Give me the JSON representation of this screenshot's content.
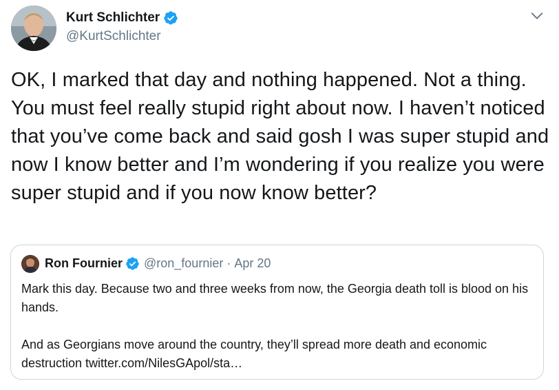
{
  "tweet": {
    "author": {
      "display_name": "Kurt Schlichter",
      "handle": "@KurtSchlichter",
      "verified": true,
      "avatar_icon": "profile-photo"
    },
    "menu_icon": "chevron-down-icon",
    "text": "OK, I marked that day and nothing happened. Not a thing. You must feel really stupid right about now. I haven’t noticed that you’ve come back and said gosh I was super stupid and now I know better and I’m wondering if you realize you were super stupid and if you now know better?"
  },
  "quoted_tweet": {
    "author": {
      "display_name": "Ron Fournier",
      "handle": "@ron_fournier",
      "verified": true,
      "avatar_icon": "profile-photo"
    },
    "separator": "·",
    "date": "Apr 20",
    "paragraph_1": "Mark this day. Because two and three weeks from now, the Georgia death toll is blood on his hands.",
    "paragraph_2": "And as Georgians move around the country, they’ll spread more death and economic destruction twitter.com/NilesGApol/sta…"
  },
  "colors": {
    "text_primary": "#14171a",
    "text_secondary": "#657786",
    "verified_blue": "#1da1f2",
    "border": "#ccd6dd"
  }
}
